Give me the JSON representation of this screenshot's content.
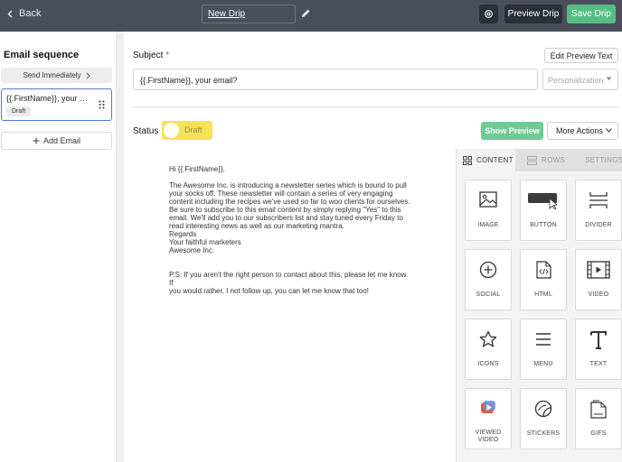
{
  "topbar": {
    "back_label": "Back",
    "drip_title": "New Drip",
    "preview_label": "Preview Drip",
    "save_label": "Save Drip"
  },
  "sidebar": {
    "title": "Email sequence",
    "send_immediately": "Send Immediately",
    "email_card": {
      "subject": "{{.FirstName}}, your e...",
      "status": "Draft"
    },
    "add_email_label": "Add Email"
  },
  "editor": {
    "subject_label": "Subject",
    "required_mark": "*",
    "edit_preview_label": "Edit Preview Text",
    "subject_value": "{{.FirstName}}, your email?",
    "personalization_placeholder": "Personalization",
    "status_label": "Status",
    "status_value": "Draft",
    "show_preview_label": "Show Preview",
    "more_actions_label": "More Actions",
    "body_lines": [
      "Hi {{.FirstName}},",
      "",
      "The Awesome Inc. is introducing a newsletter series which is bound to pull",
      "your socks off. These newsletter will contain a series of very engaging",
      "content including the recipes we've used so far to woo clients for ourselves.",
      "Be sure to subscribe to this email content by simply replying \"Yes\" to this",
      "email. We'll add you to our subscribers list and stay tuned every Friday to",
      "read interesting news as well as our marketing mantra.",
      "Regards",
      "Your faithful marketers",
      "Awesome Inc.",
      "",
      "",
      "P.S: If you aren't the right person to contact about this, please let me know. If",
      "you would rather, I not follow up, you can let me know that too!"
    ]
  },
  "builder": {
    "tabs": [
      {
        "label": "CONTENT",
        "icon": "grid-icon"
      },
      {
        "label": "ROWS",
        "icon": "rows-icon"
      },
      {
        "label": "SETTINGS",
        "icon": "settings-icon"
      }
    ],
    "tiles": [
      {
        "label": "IMAGE",
        "icon": "image-icon"
      },
      {
        "label": "BUTTON",
        "icon": "button-icon"
      },
      {
        "label": "DIVIDER",
        "icon": "divider-icon"
      },
      {
        "label": "SOCIAL",
        "icon": "social-icon"
      },
      {
        "label": "HTML",
        "icon": "html-icon"
      },
      {
        "label": "VIDEO",
        "icon": "video-icon"
      },
      {
        "label": "ICONS",
        "icon": "star-icon"
      },
      {
        "label": "MENU",
        "icon": "menu-icon"
      },
      {
        "label": "TEXT",
        "icon": "text-icon"
      },
      {
        "label": "VIEWED VIDEO",
        "icon": "viewed-video-icon"
      },
      {
        "label": "STICKERS",
        "icon": "sticker-icon"
      },
      {
        "label": "GIFS",
        "icon": "gif-icon"
      }
    ]
  },
  "colors": {
    "topbar": "#4a4f5c",
    "save_green": "#58bd85",
    "preview_green": "#6fcb96",
    "draft_yellow": "#f7e15b",
    "selected_blue": "#4d7bd1"
  }
}
